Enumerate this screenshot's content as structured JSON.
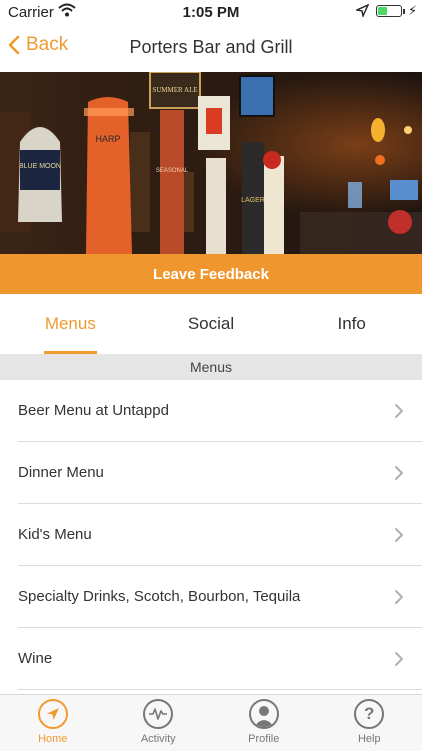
{
  "status_bar": {
    "carrier": "Carrier",
    "time": "1:05 PM",
    "battery_level": 0.45
  },
  "nav": {
    "back_label": "Back",
    "title": "Porters Bar and Grill"
  },
  "hero": {
    "tap_labels": [
      "BLUE MOON",
      "HARP",
      "SUMMER ALE",
      "SEASONAL",
      "LAGER"
    ]
  },
  "feedback": {
    "label": "Leave Feedback"
  },
  "tabs": [
    {
      "label": "Menus",
      "active": true
    },
    {
      "label": "Social",
      "active": false
    },
    {
      "label": "Info",
      "active": false
    }
  ],
  "section_header": "Menus",
  "menus": [
    {
      "label": "Beer Menu at Untappd"
    },
    {
      "label": "Dinner Menu"
    },
    {
      "label": "Kid's Menu"
    },
    {
      "label": "Specialty Drinks, Scotch, Bourbon, Tequila"
    },
    {
      "label": "Wine"
    }
  ],
  "tab_bar": [
    {
      "label": "Home",
      "icon": "navigation-arrow-icon",
      "active": true
    },
    {
      "label": "Activity",
      "icon": "activity-pulse-icon",
      "active": false
    },
    {
      "label": "Profile",
      "icon": "profile-icon",
      "active": false
    },
    {
      "label": "Help",
      "icon": "help-icon",
      "active": false
    }
  ],
  "colors": {
    "accent": "#f09a30",
    "feedback_bg": "#f0962e",
    "section_bg": "#e5e5e5",
    "battery_fill": "#4cd964"
  }
}
